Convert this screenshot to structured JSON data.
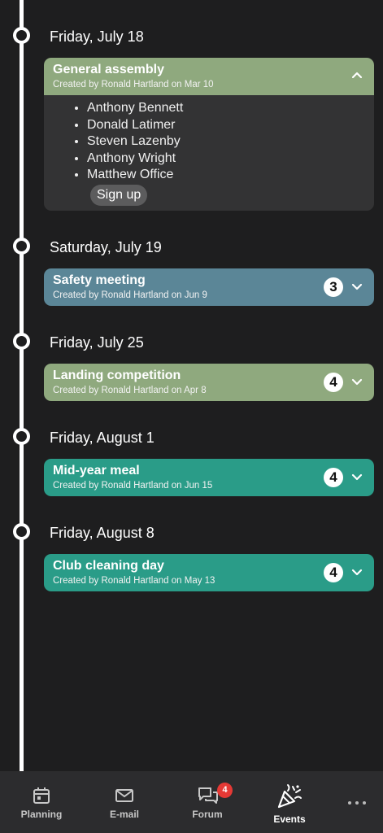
{
  "events": [
    {
      "date": "Friday, July 18",
      "title": "General assembly",
      "created": "Created by Ronald Hartland on Mar 10",
      "color": "#8fa97e",
      "expanded": true,
      "attendees": [
        "Anthony Bennett",
        "Donald Latimer",
        "Steven Lazenby",
        "Anthony Wright",
        "Matthew Office"
      ],
      "signup_label": "Sign up"
    },
    {
      "date": "Saturday, July 19",
      "title": "Safety meeting",
      "created": "Created by Ronald Hartland on Jun 9",
      "count": "3",
      "color": "#5b8697"
    },
    {
      "date": "Friday, July 25",
      "title": "Landing competition",
      "created": "Created by Ronald Hartland on Apr 8",
      "count": "4",
      "color": "#8fa97e"
    },
    {
      "date": "Friday, August 1",
      "title": "Mid-year meal",
      "created": "Created by Ronald Hartland on Jun 15",
      "count": "4",
      "color": "#2a9c88"
    },
    {
      "date": "Friday, August 8",
      "title": "Club cleaning day",
      "created": "Created by Ronald Hartland on May 13",
      "count": "4",
      "color": "#2a9c88"
    }
  ],
  "nav": {
    "items": [
      {
        "label": "Planning",
        "icon": "calendar-icon"
      },
      {
        "label": "E-mail",
        "icon": "mail-icon"
      },
      {
        "label": "Forum",
        "icon": "forum-icon",
        "badge": "4"
      },
      {
        "label": "Events",
        "icon": "party-popper-icon",
        "active": true
      }
    ],
    "more_icon": "more-horizontal-icon"
  },
  "colors": {
    "background": "#1e1e1f",
    "nav_bg": "#2c2c2e",
    "badge_red": "#e53935"
  }
}
